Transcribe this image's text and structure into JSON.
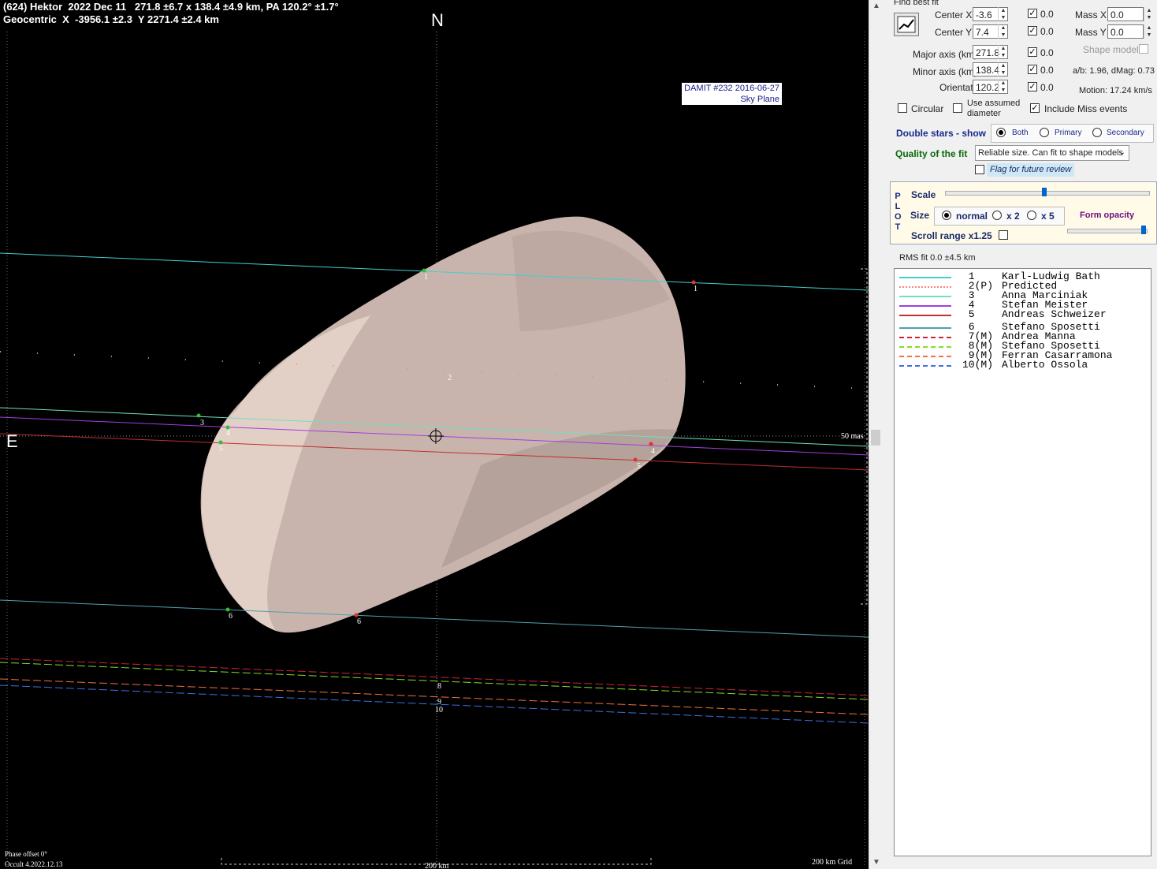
{
  "header": {
    "line1": "(624) Hektor  2022 Dec 11   271.8 ±6.7 x 138.4 ±4.9 km, PA 120.2° ±1.7°",
    "line2": "Geocentric  X  -3956.1 ±2.3  Y 2271.4 ±2.4 km"
  },
  "compass": {
    "north": "N",
    "east": "E"
  },
  "damit": {
    "line1": "DAMIT #232 2016-06-27",
    "line2": "Sky Plane"
  },
  "plot_labels": {
    "scale_mas": "50 mas",
    "phase_offset": "Phase offset 0°",
    "version": "Occult 4.2022.12.13",
    "scale_km": "200 km",
    "grid": "200 km Grid"
  },
  "chords": [
    {
      "id": "1",
      "color": "#40d0d0",
      "style": "solid"
    },
    {
      "id": "2",
      "color": "#ff8080",
      "style": "dotted"
    },
    {
      "id": "3",
      "color": "#70e0c0",
      "style": "solid"
    },
    {
      "id": "4",
      "color": "#a040e0",
      "style": "solid"
    },
    {
      "id": "5",
      "color": "#c03030",
      "style": "solid"
    },
    {
      "id": "6",
      "color": "#50a0b0",
      "style": "solid"
    },
    {
      "id": "7",
      "color": "#d02040",
      "style": "dashed"
    },
    {
      "id": "8",
      "color": "#80e020",
      "style": "dashed"
    },
    {
      "id": "9",
      "color": "#f07040",
      "style": "dashed"
    },
    {
      "id": "10",
      "color": "#4070e0",
      "style": "dashed"
    }
  ],
  "panel": {
    "find_best_fit": "Find best fit",
    "center_x_label": "Center X",
    "center_x": "-3.6",
    "center_y_label": "Center Y",
    "center_y": "7.4",
    "mass_x_label": "Mass X",
    "mass_x": "0.0",
    "mass_y_label": "Mass Y",
    "mass_y": "0.0",
    "shape_model": "Shape model",
    "major_label": "Major axis (km)",
    "major": "271.8",
    "minor_label": "Minor axis (km)",
    "minor": "138.4",
    "orient_label": "Orientation",
    "orient": "120.2",
    "fit_zero": "0.0",
    "ab_dmag": "a/b: 1.96, dMag: 0.73",
    "motion": "Motion: 17.24 km/s",
    "circular": "Circular",
    "use_assumed": "Use assumed",
    "diameter": "diameter",
    "include_miss": "Include Miss events",
    "double_stars": "Double stars - show",
    "both": "Both",
    "primary": "Primary",
    "secondary": "Secondary",
    "quality_label": "Quality of the fit",
    "quality_value": "Reliable size. Can fit to shape models",
    "flag": "Flag for future review",
    "plot_letters": [
      "P",
      "L",
      "O",
      "T"
    ],
    "scale": "Scale",
    "size": "Size",
    "normal": "normal",
    "x2": "x 2",
    "x5": "x 5",
    "form_opacity": "Form opacity",
    "scroll_range": "Scroll range x1.25",
    "rms": "RMS fit 0.0 ±4.5 km"
  },
  "legend": [
    {
      "num": "1",
      "tag": "",
      "name": "Karl-Ludwig Bath",
      "color": "#40d0d0",
      "dash": "solid"
    },
    {
      "num": "2",
      "tag": "(P)",
      "name": "Predicted",
      "color": "#ff8080",
      "dash": "dotted"
    },
    {
      "num": "3",
      "tag": "",
      "name": "Anna Marciniak",
      "color": "#70e0c0",
      "dash": "solid"
    },
    {
      "num": "4",
      "tag": "",
      "name": "Stefan Meister",
      "color": "#a040e0",
      "dash": "solid"
    },
    {
      "num": "5",
      "tag": "",
      "name": "Andreas Schweizer",
      "color": "#c03030",
      "dash": "solid"
    },
    {
      "num": "6",
      "tag": "",
      "name": "Stefano Sposetti",
      "color": "#50a0b0",
      "dash": "solid"
    },
    {
      "num": "7",
      "tag": "(M)",
      "name": "Andrea Manna",
      "color": "#d02040",
      "dash": "dashed"
    },
    {
      "num": "8",
      "tag": "(M)",
      "name": "Stefano Sposetti",
      "color": "#80e020",
      "dash": "dashed"
    },
    {
      "num": "9",
      "tag": "(M)",
      "name": "Ferran Casarramona",
      "color": "#f07040",
      "dash": "dashed"
    },
    {
      "num": "10",
      "tag": "(M)",
      "name": "Alberto Ossola",
      "color": "#4070e0",
      "dash": "dashed"
    }
  ]
}
